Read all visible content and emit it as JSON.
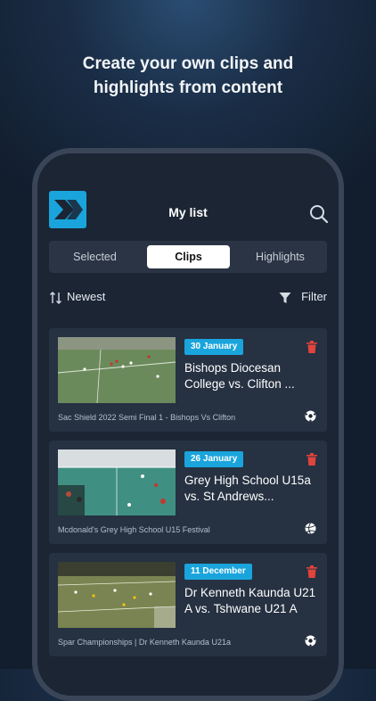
{
  "headline": {
    "line1": "Create your own clips and",
    "line2": "highlights from content"
  },
  "header": {
    "title": "My list"
  },
  "tabs": [
    {
      "label": "Selected",
      "active": false
    },
    {
      "label": "Clips",
      "active": true
    },
    {
      "label": "Highlights",
      "active": false
    }
  ],
  "sort": {
    "label": "Newest"
  },
  "filter": {
    "label": "Filter"
  },
  "colors": {
    "accent": "#1aa4dc",
    "delete": "#e0443b",
    "card": "#263142"
  },
  "cards": [
    {
      "date": "30 January",
      "title": "Bishops Diocesan College vs. Clifton ...",
      "footer": "Sac Shield 2022 Semi Final 1 - Bishops Vs Clifton",
      "sport_icon": "soccer-ball-icon"
    },
    {
      "date": "26 January",
      "title": "Grey High School U15a vs. St Andrews...",
      "footer": "Mcdonald's Grey High School U15 Festival",
      "sport_icon": "volleyball-icon"
    },
    {
      "date": "11 December",
      "title": "Dr Kenneth Kaunda U21 A vs. Tshwane U21 A",
      "footer": "Spar Championships | Dr Kenneth Kaunda U21a",
      "sport_icon": "soccer-ball-icon"
    }
  ]
}
